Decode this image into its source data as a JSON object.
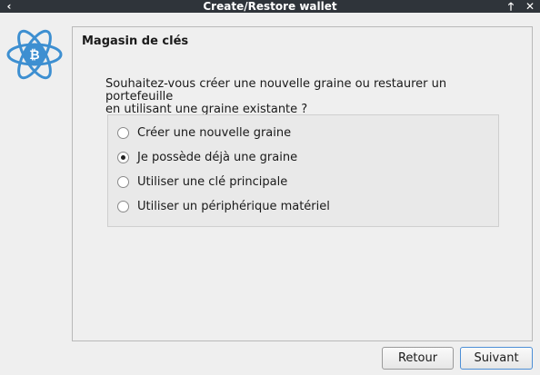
{
  "window": {
    "title": "Create/Restore wallet",
    "left_control": "‹",
    "up_control": "🡑",
    "close_control": "✕"
  },
  "colors": {
    "titlebar": "#2f343a",
    "logo": "#3d8fd1",
    "accent_border": "#4d8fd6"
  },
  "logo": {
    "icon": "electrum-bitcoin-atom-icon"
  },
  "panel": {
    "title": "Magasin de clés",
    "question_line1": "Souhaitez-vous créer une nouvelle graine ou restaurer un portefeuille",
    "question_line2": "en utilisant une graine existante ?"
  },
  "options": [
    {
      "label": "Créer une nouvelle graine",
      "checked": false
    },
    {
      "label": "Je possède déjà une graine",
      "checked": true
    },
    {
      "label": "Utiliser une clé principale",
      "checked": false
    },
    {
      "label": "Utiliser un périphérique matériel",
      "checked": false
    }
  ],
  "buttons": {
    "back": "Retour",
    "next": "Suivant"
  }
}
